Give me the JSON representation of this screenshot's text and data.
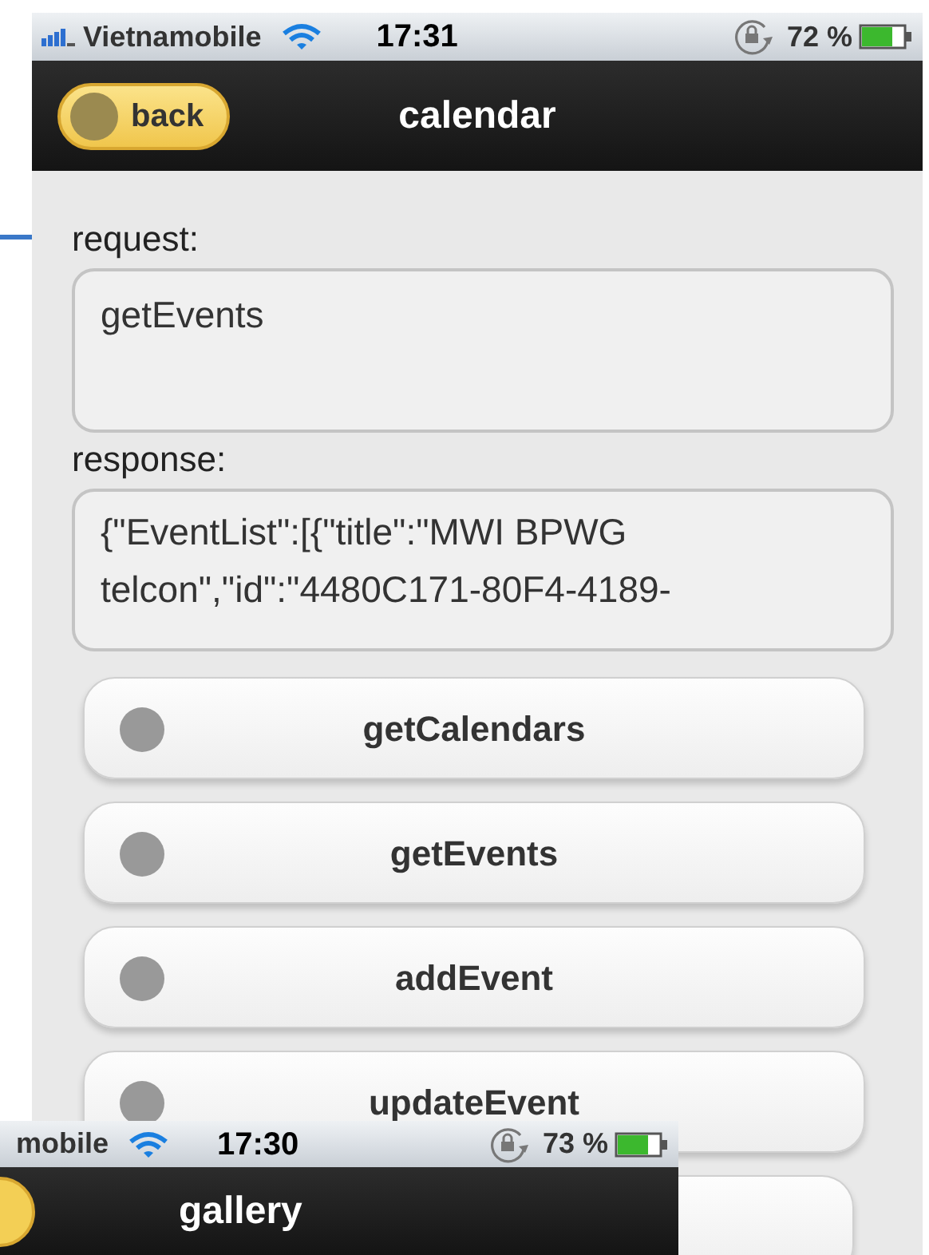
{
  "status_bar": {
    "carrier": "Vietnamobile",
    "time": "17:31",
    "battery": "72 %"
  },
  "nav_bar": {
    "back": "back",
    "title": "calendar"
  },
  "request": {
    "label": "request:",
    "value": "getEvents"
  },
  "response": {
    "label": "response:",
    "value": "{\"EventList\":[{\"title\":\"MWI BPWG telcon\",\"id\":\"4480C171-80F4-4189-"
  },
  "buttons": [
    "getCalendars",
    "getEvents",
    "addEvent",
    "updateEvent"
  ],
  "overlay": {
    "status_bar": {
      "carrier": "mobile",
      "time": "17:30",
      "battery": "73 %"
    },
    "nav_bar": {
      "title": "gallery"
    }
  }
}
